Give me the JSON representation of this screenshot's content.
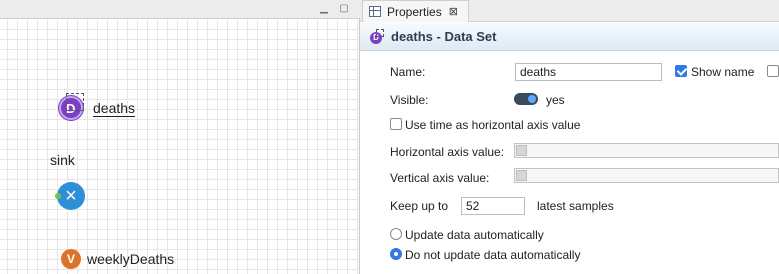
{
  "canvas": {
    "dataset_icon_letter": "D",
    "dataset_label": "deaths",
    "sink_label": "sink",
    "sink_icon": "×",
    "variable_icon_letter": "V",
    "variable_label": "weeklyDeaths"
  },
  "panel": {
    "tab_label": "Properties",
    "tab_close": "⊠",
    "header_icon_letter": "D",
    "title": "deaths - Data Set",
    "name_label": "Name:",
    "name_value": "deaths",
    "show_name_label": "Show name",
    "show_name_checked": true,
    "visible_label": "Visible:",
    "visible_value": "yes",
    "use_time_label": "Use time as horizontal axis value",
    "use_time_checked": false,
    "horizontal_label": "Horizontal axis value:",
    "vertical_label": "Vertical axis value:",
    "keep_up_label": "Keep up to",
    "keep_up_value": "52",
    "latest_samples_label": "latest samples",
    "update_auto_label": "Update data automatically",
    "no_update_label": "Do not update data automatically",
    "selected_update_option": "no_update"
  },
  "colors": {
    "dataset_icon": "#7b3fc4",
    "sink_icon": "#2d8fd8",
    "variable_icon": "#d9742a",
    "accent": "#2f7ae5"
  }
}
